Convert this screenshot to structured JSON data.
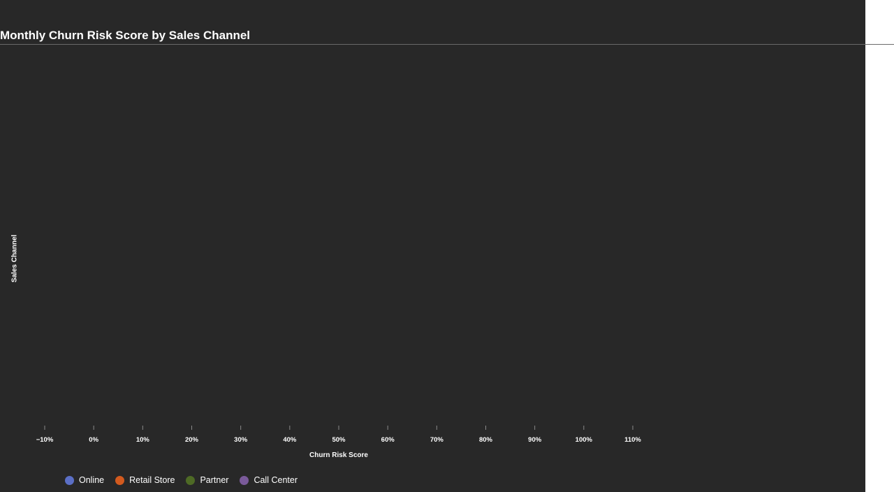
{
  "chart_data": {
    "type": "bar",
    "title": "Monthly Churn Risk Score by Sales Channel",
    "xlabel": "Churn Risk Score",
    "ylabel": "Sales Channel",
    "orientation": "horizontal",
    "xlim": [
      -0.1,
      1.1
    ],
    "x_ticks": [
      -0.1,
      0,
      0.1,
      0.2,
      0.3,
      0.4,
      0.5,
      0.6,
      0.7,
      0.8,
      0.9,
      1.0,
      1.1
    ],
    "x_tick_labels": [
      "−10%",
      "0%",
      "10%",
      "20%",
      "30%",
      "40%",
      "50%",
      "60%",
      "70%",
      "80%",
      "90%",
      "100%",
      "110%"
    ],
    "categories": [],
    "series": [
      {
        "name": "Online",
        "color": "#5b6fc6",
        "values": []
      },
      {
        "name": "Retail Store",
        "color": "#d35a1e",
        "values": []
      },
      {
        "name": "Partner",
        "color": "#4e6a25",
        "values": []
      },
      {
        "name": "Call Center",
        "color": "#7a5a9a",
        "values": []
      }
    ],
    "grid": false,
    "legend_position": "bottom-left"
  }
}
